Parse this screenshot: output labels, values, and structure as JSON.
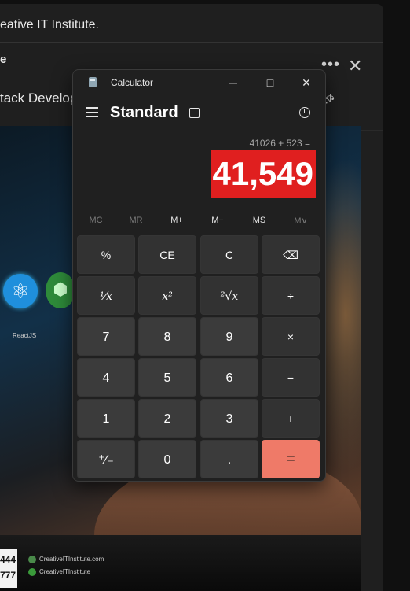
{
  "background_app": {
    "post_title": "eative IT Institute.",
    "author": "e",
    "post_text": "tack Developm",
    "more_label": "•••",
    "close_label": "✕",
    "translate_glyph": "ক়",
    "photo": {
      "react_caption": "ReactJS",
      "number_box_1": "444",
      "number_box_2": "777",
      "credit_site": "CreativeITInstitute.com",
      "credit_social": "CreativeITInstitute"
    }
  },
  "calculator": {
    "window_title": "Calculator",
    "minimize": "─",
    "maximize": "□",
    "close": "✕",
    "menu_icon": "hamburger-icon",
    "mode": "Standard",
    "expression": "41026 + 523 =",
    "result": "41,549",
    "memory": {
      "mc": "MC",
      "mr": "MR",
      "mplus": "M+",
      "mminus": "M−",
      "ms": "MS",
      "mlist": "M∨"
    },
    "keys": {
      "percent": "%",
      "ce": "CE",
      "c": "C",
      "backspace": "⌫",
      "reciprocal": "¹⁄x",
      "square": "x²",
      "sqrt": "²√x",
      "divide": "÷",
      "seven": "7",
      "eight": "8",
      "nine": "9",
      "multiply": "×",
      "four": "4",
      "five": "5",
      "six": "6",
      "minus": "−",
      "one": "1",
      "two": "2",
      "three": "3",
      "plus": "+",
      "negate": "⁺∕₋",
      "zero": "0",
      "decimal": ".",
      "equals": "="
    },
    "colors": {
      "result_highlight": "#e01f1f",
      "equals_accent": "#ef7a68"
    }
  }
}
